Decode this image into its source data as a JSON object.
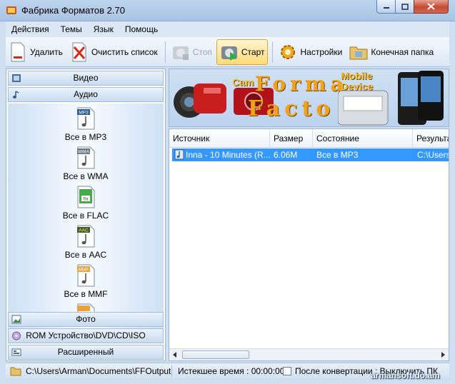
{
  "window": {
    "title": "Фабрика Форматов 2.70"
  },
  "menu": [
    "Действия",
    "Темы",
    "Язык",
    "Помощь"
  ],
  "toolbar": {
    "delete": "Удалить",
    "clear": "Очистить список",
    "stop": "Стоп",
    "start": "Старт",
    "settings": "Настройки",
    "output_folder": "Конечная папка"
  },
  "categories": {
    "video": "Видео",
    "audio": "Аудио",
    "photo": "Фото",
    "rom": "ROM Устройство\\DVD\\CD\\ISO",
    "advanced": "Расширенный"
  },
  "audio_formats": [
    {
      "tag": "MP3",
      "label": "Все в MP3"
    },
    {
      "tag": "WMA",
      "label": "Все в WMA"
    },
    {
      "tag": "fla",
      "label": "Все в FLAC"
    },
    {
      "tag": "AAC",
      "label": "Все в AAC"
    },
    {
      "tag": "MMF",
      "label": "Все в MMF"
    }
  ],
  "banner": {
    "line1": "Forma",
    "line2": "Facto",
    "camera": "Cam",
    "mobile1": "Mobile",
    "mobile2": "Device"
  },
  "table": {
    "columns": [
      "Источник",
      "Размер",
      "Состояние",
      "Результат"
    ],
    "rows": [
      {
        "source": "Inna - 10 Minutes (R...",
        "size": "6.06M",
        "status": "Все в MP3",
        "result": "C:\\Users"
      }
    ]
  },
  "status": {
    "path": "C:\\Users\\Arman\\Documents\\FFOutput",
    "elapsed": "Истекшее время : 00:00:00",
    "after": "После конвертации : Выключить ПК"
  },
  "watermark": "armansoft.do.am",
  "colors": {
    "accent": "#3399ff",
    "banner_text": "#f2a21a"
  }
}
